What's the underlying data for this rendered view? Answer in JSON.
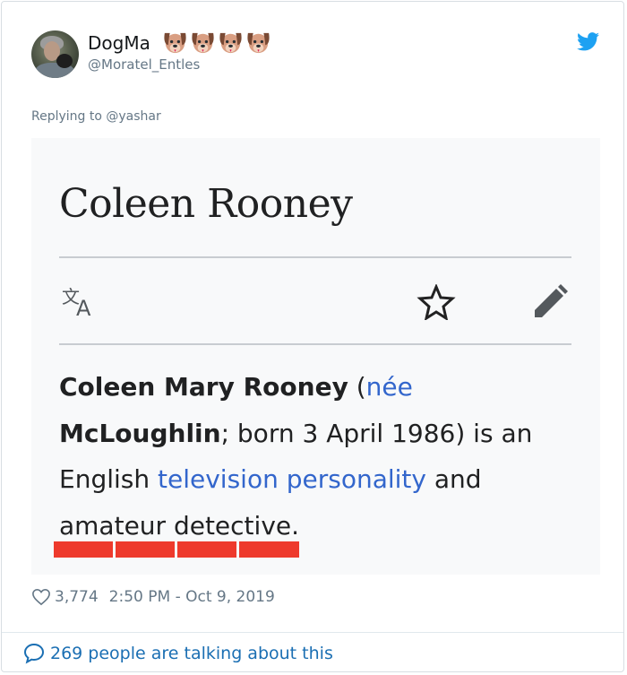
{
  "tweet": {
    "display_name": "DogMa",
    "name_emojis": [
      "dog-face-icon",
      "dog-face-icon",
      "dog-face-icon",
      "dog-face-icon"
    ],
    "handle": "@Moratel_Entles",
    "replying_prefix": "Replying to ",
    "replying_to": "@yashar",
    "like_count": "3,774",
    "timestamp": "2:50 PM - Oct 9, 2019",
    "talking_text": "269 people are talking about this"
  },
  "wiki": {
    "title": "Coleen Rooney",
    "bold_name_1": "Coleen Mary Rooney",
    "paren_open": " (",
    "nee_link": "née",
    "bold_name_2": "McLoughlin",
    "born_text": "; born 3 April 1986) is an English ",
    "tv_link": "television personality",
    "and_text": " and",
    "ending": "amateur detective."
  },
  "colors": {
    "twitter_blue": "#1da1f2",
    "wiki_link": "#3366cc",
    "underline_red": "#ee3a2c",
    "meta_gray": "#657786"
  }
}
